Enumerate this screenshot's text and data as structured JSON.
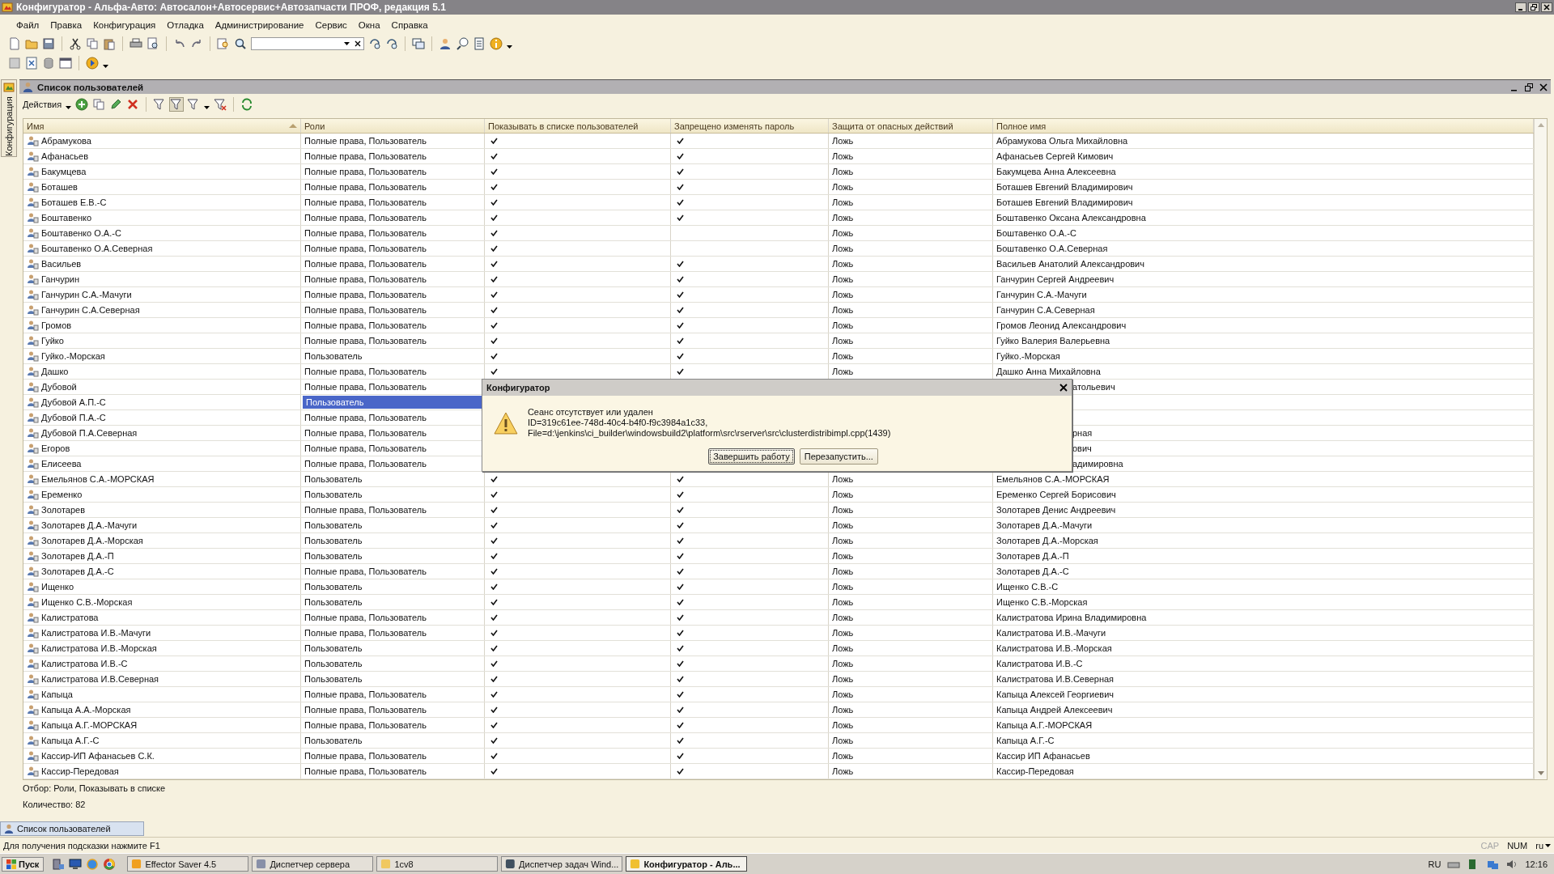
{
  "window": {
    "title": "Конфигуратор - Альфа-Авто: Автосалон+Автосервис+Автозапчасти ПРОФ, редакция 5.1"
  },
  "menu": [
    "Файл",
    "Правка",
    "Конфигурация",
    "Отладка",
    "Администрирование",
    "Сервис",
    "Окна",
    "Справка"
  ],
  "side_panel": {
    "label": "Конфигурация"
  },
  "child_window": {
    "title": "Список пользователей",
    "actions": "Действия"
  },
  "table": {
    "columns": [
      "Имя",
      "Роли",
      "Показывать в списке пользователей",
      "Запрещено изменять пароль",
      "Защита от опасных действий",
      "Полное имя"
    ],
    "rows": [
      {
        "name": "Абрамукова",
        "roles": "Полные права, Пользователь",
        "show_in_list": true,
        "password_locked": true,
        "protection": "Ложь",
        "full_name": "Абрамукова Ольга Михайловна",
        "selected": false
      },
      {
        "name": "Афанасьев",
        "roles": "Полные права, Пользователь",
        "show_in_list": true,
        "password_locked": true,
        "protection": "Ложь",
        "full_name": "Афанасьев Сергей Кимович",
        "selected": false
      },
      {
        "name": "Бакумцева",
        "roles": "Полные права, Пользователь",
        "show_in_list": true,
        "password_locked": true,
        "protection": "Ложь",
        "full_name": "Бакумцева Анна Алексеевна",
        "selected": false
      },
      {
        "name": "Боташев",
        "roles": "Полные права, Пользователь",
        "show_in_list": true,
        "password_locked": true,
        "protection": "Ложь",
        "full_name": "Боташев Евгений Владимирович",
        "selected": false
      },
      {
        "name": "Боташев Е.В.-С",
        "roles": "Полные права, Пользователь",
        "show_in_list": true,
        "password_locked": true,
        "protection": "Ложь",
        "full_name": "Боташев Евгений Владимирович",
        "selected": false
      },
      {
        "name": "Боштавенко",
        "roles": "Полные права, Пользователь",
        "show_in_list": true,
        "password_locked": true,
        "protection": "Ложь",
        "full_name": "Боштавенко Оксана Александровна",
        "selected": false
      },
      {
        "name": "Боштавенко О.А.-С",
        "roles": "Полные права, Пользователь",
        "show_in_list": true,
        "password_locked": false,
        "protection": "Ложь",
        "full_name": "Боштавенко О.А.-С",
        "selected": false
      },
      {
        "name": "Боштавенко О.А.Северная",
        "roles": "Полные права, Пользователь",
        "show_in_list": true,
        "password_locked": false,
        "protection": "Ложь",
        "full_name": "Боштавенко О.А.Северная",
        "selected": false
      },
      {
        "name": "Васильев",
        "roles": "Полные права, Пользователь",
        "show_in_list": true,
        "password_locked": true,
        "protection": "Ложь",
        "full_name": "Васильев Анатолий Александрович",
        "selected": false
      },
      {
        "name": "Ганчурин",
        "roles": "Полные права, Пользователь",
        "show_in_list": true,
        "password_locked": true,
        "protection": "Ложь",
        "full_name": "Ганчурин Сергей Андреевич",
        "selected": false
      },
      {
        "name": "Ганчурин С.А.-Мачуги",
        "roles": "Полные права, Пользователь",
        "show_in_list": true,
        "password_locked": true,
        "protection": "Ложь",
        "full_name": "Ганчурин С.А.-Мачуги",
        "selected": false
      },
      {
        "name": "Ганчурин С.А.Северная",
        "roles": "Полные права, Пользователь",
        "show_in_list": true,
        "password_locked": true,
        "protection": "Ложь",
        "full_name": "Ганчурин С.А.Северная",
        "selected": false
      },
      {
        "name": "Громов",
        "roles": "Полные права, Пользователь",
        "show_in_list": true,
        "password_locked": true,
        "protection": "Ложь",
        "full_name": "Громов Леонид Александрович",
        "selected": false
      },
      {
        "name": "Гуйко",
        "roles": "Полные права, Пользователь",
        "show_in_list": true,
        "password_locked": true,
        "protection": "Ложь",
        "full_name": "Гуйко Валерия Валерьевна",
        "selected": false
      },
      {
        "name": "Гуйко.-Морская",
        "roles": "Пользователь",
        "show_in_list": true,
        "password_locked": true,
        "protection": "Ложь",
        "full_name": "Гуйко.-Морская",
        "selected": false
      },
      {
        "name": "Дашко",
        "roles": "Полные права, Пользователь",
        "show_in_list": true,
        "password_locked": true,
        "protection": "Ложь",
        "full_name": "Дашко Анна Михайловна",
        "selected": false
      },
      {
        "name": "Дубовой",
        "roles": "Полные права, Пользователь",
        "full_name": "атольевич",
        "selected": false
      },
      {
        "name": "Дубовой А.П.-С",
        "roles": "Пользователь",
        "selected": true
      },
      {
        "name": "Дубовой П.А.-С",
        "roles": "Полные права, Пользователь",
        "selected": false
      },
      {
        "name": "Дубовой П.А.Северная",
        "roles": "Полные права, Пользователь",
        "full_name": "рная",
        "selected": false
      },
      {
        "name": "Егоров",
        "roles": "Полные права, Пользователь",
        "full_name": "ович",
        "selected": false
      },
      {
        "name": "Елисеева",
        "roles": "Полные права, Пользователь",
        "full_name": "адимировна",
        "selected": false
      },
      {
        "name": "Емельянов С.А.-МОРСКАЯ",
        "roles": "Пользователь",
        "show_in_list": true,
        "password_locked": true,
        "protection": "Ложь",
        "full_name": "Емельянов С.А.-МОРСКАЯ",
        "selected": false
      },
      {
        "name": "Еременко",
        "roles": "Пользователь",
        "show_in_list": true,
        "password_locked": true,
        "protection": "Ложь",
        "full_name": "Еременко Сергей Борисович",
        "selected": false
      },
      {
        "name": "Золотарев",
        "roles": "Полные права, Пользователь",
        "show_in_list": true,
        "password_locked": true,
        "protection": "Ложь",
        "full_name": "Золотарев Денис Андреевич",
        "selected": false
      },
      {
        "name": "Золотарев Д.А.-Мачуги",
        "roles": "Пользователь",
        "show_in_list": true,
        "password_locked": true,
        "protection": "Ложь",
        "full_name": "Золотарев Д.А.-Мачуги",
        "selected": false
      },
      {
        "name": "Золотарев Д.А.-Морская",
        "roles": "Пользователь",
        "show_in_list": true,
        "password_locked": true,
        "protection": "Ложь",
        "full_name": "Золотарев Д.А.-Морская",
        "selected": false
      },
      {
        "name": "Золотарев Д.А.-П",
        "roles": "Пользователь",
        "show_in_list": true,
        "password_locked": true,
        "protection": "Ложь",
        "full_name": "Золотарев Д.А.-П",
        "selected": false
      },
      {
        "name": "Золотарев Д.А.-С",
        "roles": "Полные права, Пользователь",
        "show_in_list": true,
        "password_locked": true,
        "protection": "Ложь",
        "full_name": "Золотарев Д.А.-С",
        "selected": false
      },
      {
        "name": "Ищенко",
        "roles": "Пользователь",
        "show_in_list": true,
        "password_locked": true,
        "protection": "Ложь",
        "full_name": "Ищенко С.В.-С",
        "selected": false
      },
      {
        "name": "Ищенко С.В.-Морская",
        "roles": "Пользователь",
        "show_in_list": true,
        "password_locked": true,
        "protection": "Ложь",
        "full_name": "Ищенко С.В.-Морская",
        "selected": false
      },
      {
        "name": "Калистратова",
        "roles": "Полные права, Пользователь",
        "show_in_list": true,
        "password_locked": true,
        "protection": "Ложь",
        "full_name": "Калистратова Ирина Владимировна",
        "selected": false
      },
      {
        "name": "Калистратова И.В.-Мачуги",
        "roles": "Полные права, Пользователь",
        "show_in_list": true,
        "password_locked": true,
        "protection": "Ложь",
        "full_name": "Калистратова И.В.-Мачуги",
        "selected": false
      },
      {
        "name": "Калистратова И.В.-Морская",
        "roles": "Пользователь",
        "show_in_list": true,
        "password_locked": true,
        "protection": "Ложь",
        "full_name": "Калистратова И.В.-Морская",
        "selected": false
      },
      {
        "name": "Калистратова И.В.-С",
        "roles": "Пользователь",
        "show_in_list": true,
        "password_locked": true,
        "protection": "Ложь",
        "full_name": "Калистратова И.В.-С",
        "selected": false
      },
      {
        "name": "Калистратова И.В.Северная",
        "roles": "Пользователь",
        "show_in_list": true,
        "password_locked": true,
        "protection": "Ложь",
        "full_name": "Калистратова И.В.Северная",
        "selected": false
      },
      {
        "name": "Капыца",
        "roles": "Полные права, Пользователь",
        "show_in_list": true,
        "password_locked": true,
        "protection": "Ложь",
        "full_name": "Капыца Алексей Георгиевич",
        "selected": false
      },
      {
        "name": "Капыца А.А.-Морская",
        "roles": "Полные права, Пользователь",
        "show_in_list": true,
        "password_locked": true,
        "protection": "Ложь",
        "full_name": "Капыца Андрей Алексеевич",
        "selected": false
      },
      {
        "name": "Капыца А.Г.-МОРСКАЯ",
        "roles": "Полные права, Пользователь",
        "show_in_list": true,
        "password_locked": true,
        "protection": "Ложь",
        "full_name": "Капыца А.Г.-МОРСКАЯ",
        "selected": false
      },
      {
        "name": "Капыца А.Г.-С",
        "roles": "Пользователь",
        "show_in_list": true,
        "password_locked": true,
        "protection": "Ложь",
        "full_name": "Капыца А.Г.-С",
        "selected": false
      },
      {
        "name": "Кассир-ИП Афанасьев С.К.",
        "roles": "Полные права, Пользователь",
        "show_in_list": true,
        "password_locked": true,
        "protection": "Ложь",
        "full_name": "Кассир ИП Афанасьев",
        "selected": false
      },
      {
        "name": "Кассир-Передовая",
        "roles": "Полные права, Пользователь",
        "show_in_list": true,
        "password_locked": true,
        "protection": "Ложь",
        "full_name": "Кассир-Передовая",
        "selected": false
      }
    ]
  },
  "filter": "Отбор:  Роли, Показывать в списке",
  "count": "Количество: 82",
  "window_tabs": [
    {
      "label": "Список пользователей",
      "selected": true
    }
  ],
  "status_bar": {
    "hint": "Для получения подсказки нажмите F1",
    "indicators": [
      {
        "label": "CAP",
        "on": false
      },
      {
        "label": "NUM",
        "on": true
      }
    ],
    "language": "ru"
  },
  "taskbar": {
    "start": "Пуск",
    "tasks": [
      {
        "label": "Effector Saver 4.5",
        "selected": false
      },
      {
        "label": "Диспетчер сервера",
        "selected": false
      },
      {
        "label": "1cv8",
        "selected": false
      },
      {
        "label": "Диспетчер задач Wind...",
        "selected": false
      },
      {
        "label": "Конфигуратор - Аль...",
        "selected": true
      }
    ],
    "language": "RU",
    "clock": "12:16"
  },
  "dialog": {
    "title": "Конфигуратор",
    "message": [
      "Сеанс отсутствует или удален",
      "ID=319c61ee-748d-40c4-b4f0-f9c3984a1c33, File=d:\\jenkins\\ci_builder\\windowsbuild2\\platform\\src\\rserver\\src\\clusterdistribimpl.cpp(1439)"
    ],
    "buttons": [
      {
        "label": "Завершить работу",
        "selected": true
      },
      {
        "label": "Перезапустить...",
        "selected": false
      }
    ]
  }
}
